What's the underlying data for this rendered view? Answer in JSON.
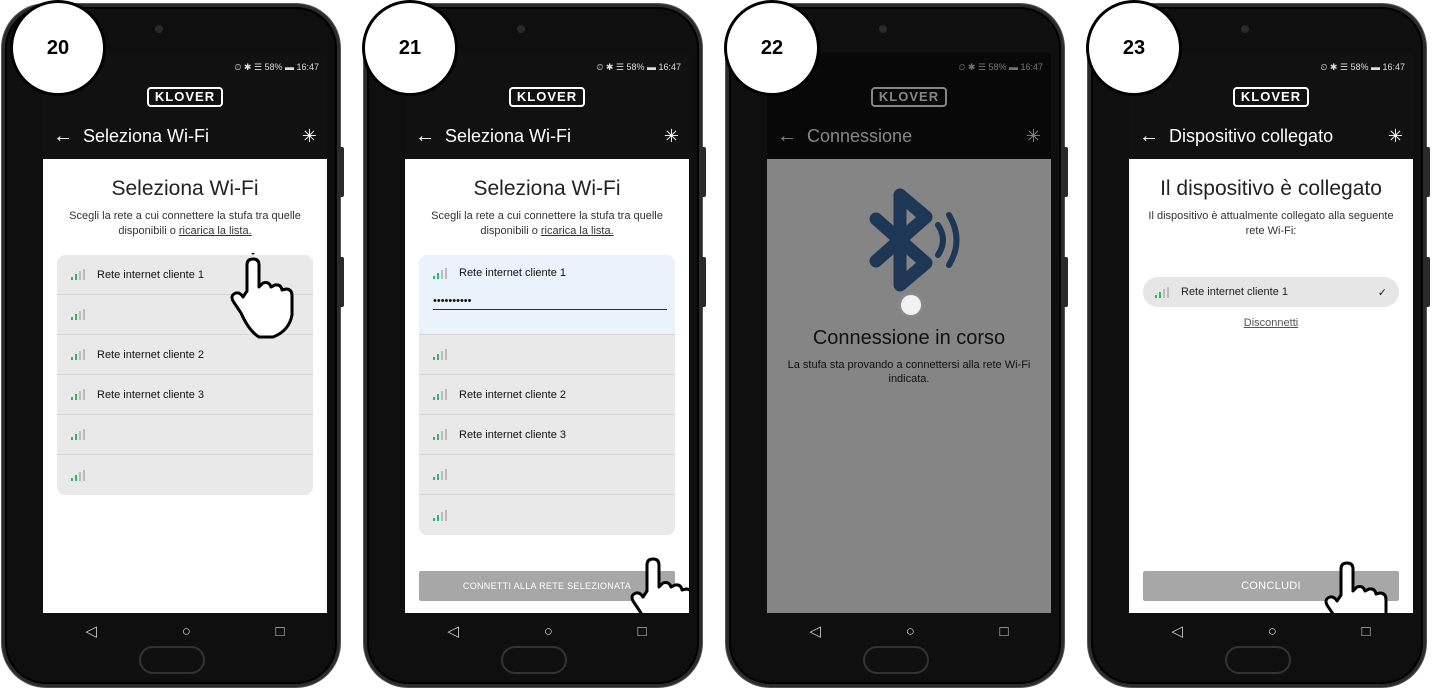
{
  "statusbar": {
    "text": "⏲ ✱ ☰ 58% ▬ 16:47"
  },
  "brand": "KLOVER",
  "nav": {
    "back": "◁",
    "home": "○",
    "recents": "□"
  },
  "icons": {
    "back_arrow": "←",
    "bluetooth": "✳"
  },
  "steps": [
    {
      "number": "20",
      "appbar_title": "Seleziona Wi-Fi",
      "heading": "Seleziona Wi-Fi",
      "desc": "Scegli la rete a cui connettere la stufa tra quelle disponibili o",
      "desc_link": "ricarica la lista.",
      "networks": [
        "Rete internet cliente 1",
        "",
        "Rete internet cliente 2",
        "Rete internet cliente 3",
        "",
        ""
      ]
    },
    {
      "number": "21",
      "appbar_title": "Seleziona Wi-Fi",
      "heading": "Seleziona Wi-Fi",
      "desc": "Scegli la rete a cui connettere la stufa tra quelle disponibili o",
      "desc_link": "ricarica la lista.",
      "selected_network": "Rete internet cliente 1",
      "password_value": "••••••••••",
      "networks": [
        "",
        "Rete internet cliente 2",
        "Rete internet cliente 3",
        "",
        ""
      ],
      "button": "CONNETTI ALLA RETE SELEZIONATA"
    },
    {
      "number": "22",
      "appbar_title": "Connessione",
      "heading": "Connessione in corso",
      "desc": "La stufa sta provando a connettersi alla rete Wi-Fi indicata."
    },
    {
      "number": "23",
      "appbar_title": "Dispositivo collegato",
      "heading": "Il dispositivo è collegato",
      "desc": "Il dispositivo è attualmente collegato alla seguente rete Wi-Fi:",
      "network": "Rete internet cliente 1",
      "check": "✓",
      "disconnect": "Disconnetti",
      "button": "CONCLUDI"
    }
  ]
}
